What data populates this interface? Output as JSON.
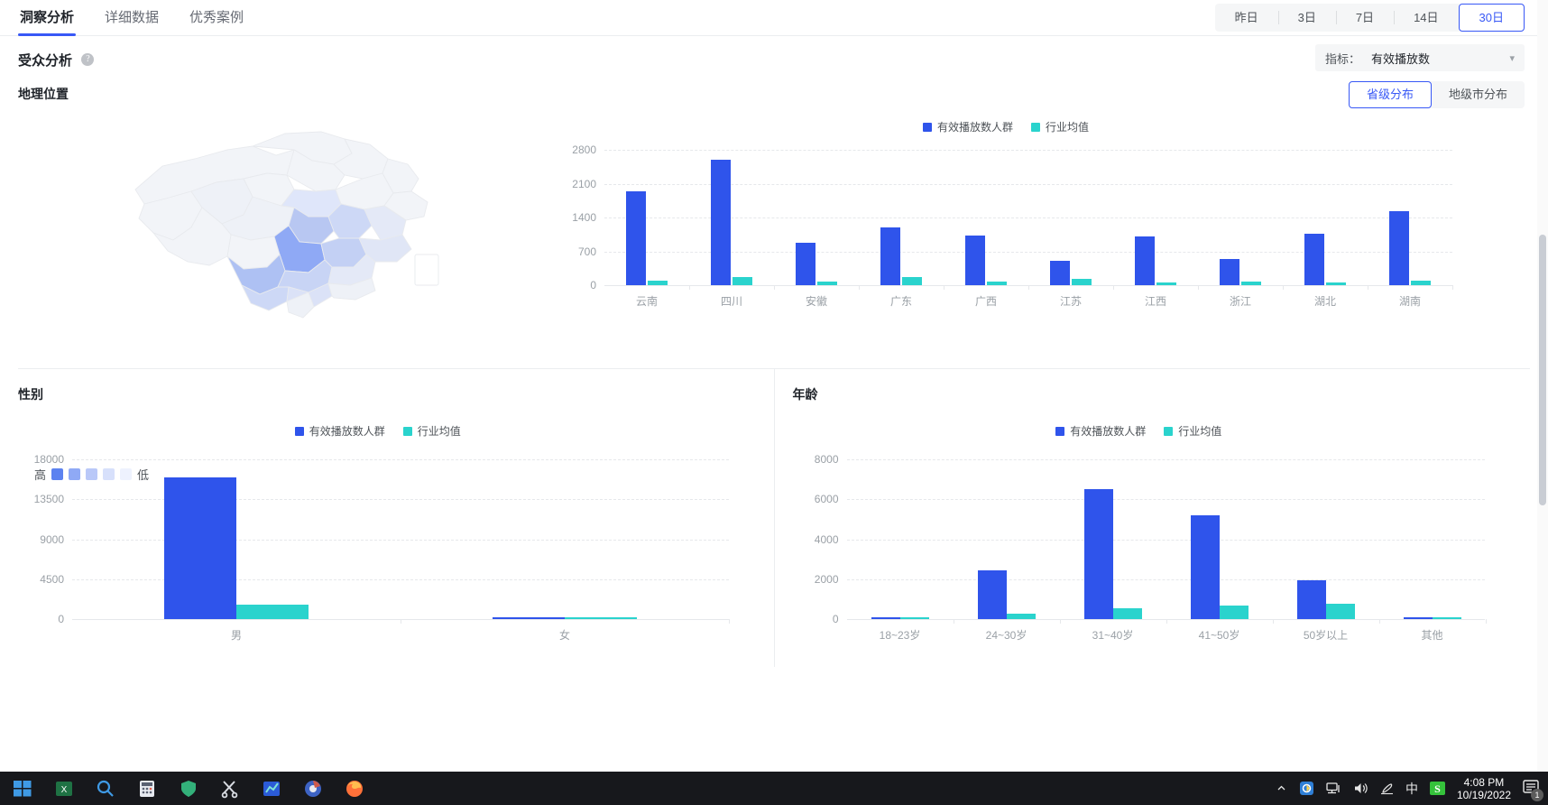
{
  "tabs": [
    {
      "label": "洞察分析",
      "active": true
    },
    {
      "label": "详细数据",
      "active": false
    },
    {
      "label": "优秀案例",
      "active": false
    }
  ],
  "date_range": {
    "options": [
      "昨日",
      "3日",
      "7日",
      "14日",
      "30日"
    ],
    "selected": "30日"
  },
  "audience": {
    "title": "受众分析",
    "help_icon": "question-mark-icon",
    "metric": {
      "label": "指标：",
      "value": "有效播放数",
      "chevron": "chevron-down-icon"
    }
  },
  "geo": {
    "title": "地理位置",
    "view_options": [
      "省级分布",
      "地级市分布"
    ],
    "view_selected": "省级分布",
    "map_legend": {
      "high": "高",
      "low": "低",
      "swatches": [
        "#5c82f0",
        "#8fa9f5",
        "#b9c8f8",
        "#d7e0fb",
        "#eef2fe"
      ]
    }
  },
  "colors": {
    "accent": "#3858f6",
    "series_blue": "#2f54eb",
    "series_teal": "#2ad3cd",
    "text_primary": "#1f2329",
    "text_secondary": "#9aa0a6",
    "grid": "#e6e8eb"
  },
  "sections": {
    "gender_title": "性别",
    "age_title": "年龄"
  },
  "chart_data": [
    {
      "id": "geo-chart",
      "type": "bar",
      "title": "",
      "xlabel": "",
      "ylabel": "",
      "grid": true,
      "legend_position": "top-center",
      "categories": [
        "云南",
        "四川",
        "安徽",
        "广东",
        "广西",
        "江苏",
        "江西",
        "浙江",
        "湖北",
        "湖南"
      ],
      "yticks": [
        0,
        700,
        1400,
        2100,
        2800
      ],
      "ylim": [
        0,
        2800
      ],
      "series": [
        {
          "name": "有效播放数人群",
          "color": "#2f54eb",
          "values": [
            1950,
            2590,
            880,
            1200,
            1030,
            500,
            1000,
            550,
            1060,
            1530
          ]
        },
        {
          "name": "行业均值",
          "color": "#2ad3cd",
          "values": [
            90,
            160,
            80,
            160,
            70,
            140,
            60,
            70,
            60,
            90
          ]
        }
      ]
    },
    {
      "id": "gender-chart",
      "type": "bar",
      "title": "性别",
      "xlabel": "",
      "ylabel": "",
      "grid": true,
      "legend_position": "top-center",
      "categories": [
        "男",
        "女"
      ],
      "yticks": [
        0,
        4500,
        9000,
        13500,
        18000
      ],
      "ylim": [
        0,
        18000
      ],
      "series": [
        {
          "name": "有效播放数人群",
          "color": "#2f54eb",
          "values": [
            16000,
            130
          ]
        },
        {
          "name": "行业均值",
          "color": "#2ad3cd",
          "values": [
            1600,
            90
          ]
        }
      ]
    },
    {
      "id": "age-chart",
      "type": "bar",
      "title": "年龄",
      "xlabel": "",
      "ylabel": "",
      "grid": true,
      "legend_position": "top-center",
      "categories": [
        "18~23岁",
        "24~30岁",
        "31~40岁",
        "41~50岁",
        "50岁以上",
        "其他"
      ],
      "yticks": [
        0,
        2000,
        4000,
        6000,
        8000
      ],
      "ylim": [
        0,
        8000
      ],
      "series": [
        {
          "name": "有效播放数人群",
          "color": "#2f54eb",
          "values": [
            90,
            2450,
            6500,
            5200,
            1950,
            70
          ]
        },
        {
          "name": "行业均值",
          "color": "#2ad3cd",
          "values": [
            60,
            270,
            560,
            660,
            760,
            50
          ]
        }
      ]
    }
  ],
  "taskbar": {
    "apps": [
      "windows-start-icon",
      "excel-icon",
      "search-icon",
      "calculator-icon",
      "shield-icon",
      "scissors-icon",
      "chart-icon",
      "browser-icon",
      "firefox-icon"
    ],
    "tray": [
      "chevron-up-icon",
      "screenshot-icon",
      "network-icon",
      "volume-icon",
      "pen-icon",
      "ime-chinese-icon",
      "sogou-icon"
    ],
    "clock_time": "4:08 PM",
    "clock_date": "10/19/2022",
    "notification_count": "1",
    "ime_label": "中",
    "sogou_label": "S"
  }
}
